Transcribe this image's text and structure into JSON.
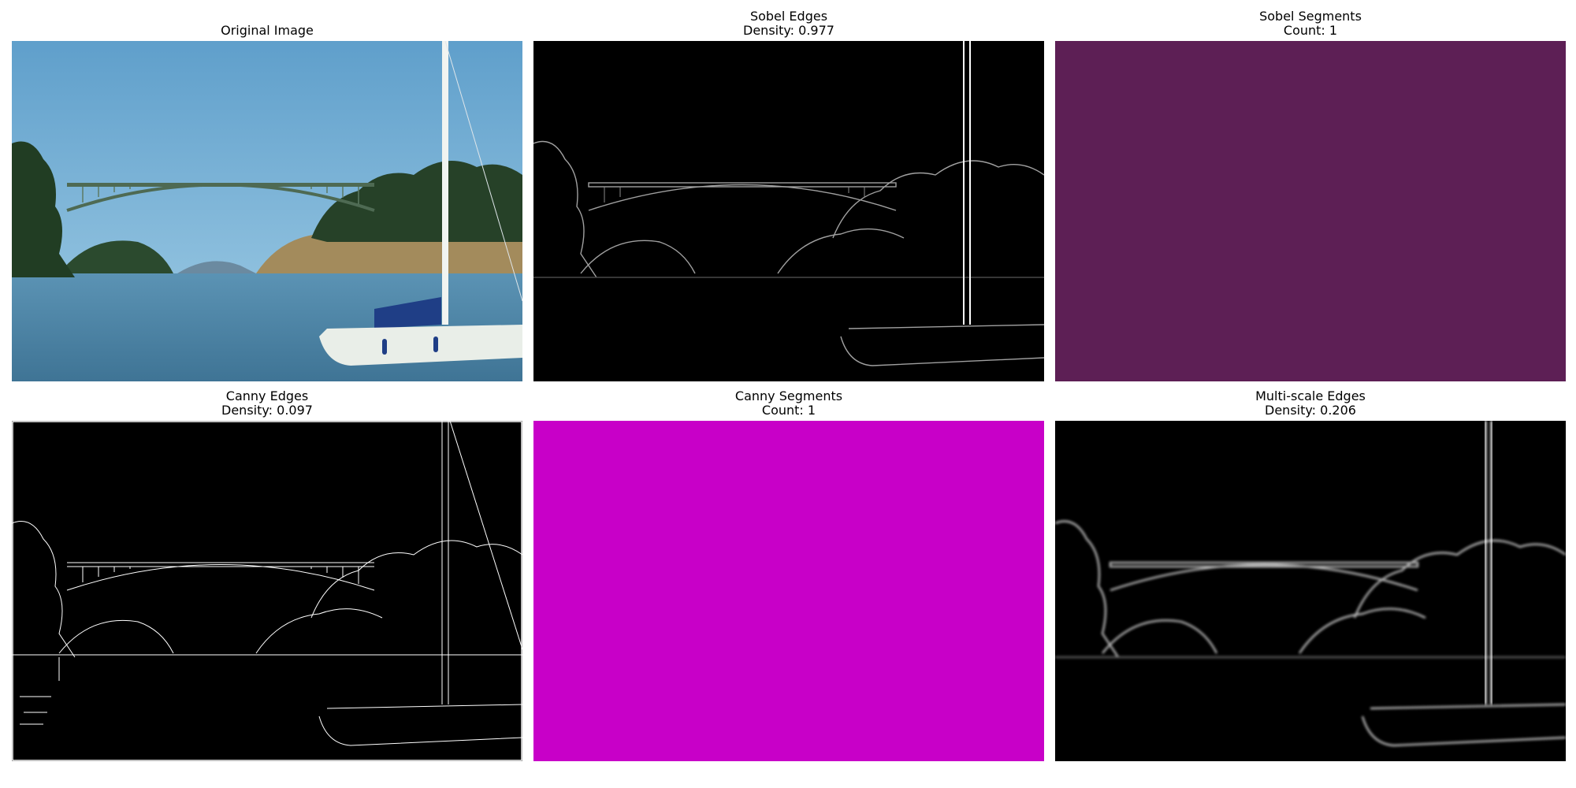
{
  "panels": [
    {
      "id": "original",
      "title": "Original Image",
      "subtitle": ""
    },
    {
      "id": "sobel-edges",
      "title": "Sobel Edges",
      "subtitle": "Density: 0.977"
    },
    {
      "id": "sobel-segments",
      "title": "Sobel Segments",
      "subtitle": "Count: 1",
      "fill": "#5d1f55"
    },
    {
      "id": "canny-edges",
      "title": "Canny Edges",
      "subtitle": "Density: 0.097"
    },
    {
      "id": "canny-segments",
      "title": "Canny Segments",
      "subtitle": "Count: 1",
      "fill": "#c800c8"
    },
    {
      "id": "multiscale-edges",
      "title": "Multi-scale Edges",
      "subtitle": "Density: 0.206"
    }
  ],
  "colors": {
    "sky": "#62a6cf",
    "water": "#4f87a8",
    "foliage": "#2f4b2f",
    "hill": "#a08a5e",
    "boat": "#e9eee8",
    "sail_cover": "#1f3e86",
    "edge": "#ffffff",
    "background": "#000000"
  }
}
